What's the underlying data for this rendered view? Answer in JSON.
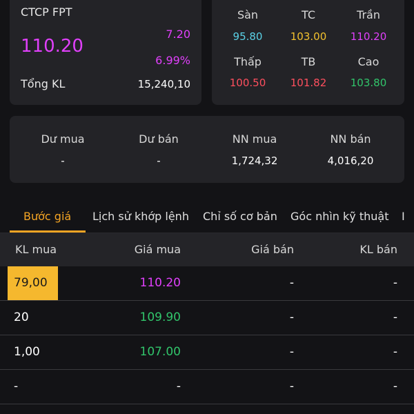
{
  "quote": {
    "company": "CTCP FPT",
    "price": "110.20",
    "change": "7.20",
    "change_pct": "6.99%",
    "volume_label": "Tổng KL",
    "volume": "15,240,10"
  },
  "stats": [
    {
      "label": "Sàn",
      "value": "95.80",
      "color": "#5ad1e6"
    },
    {
      "label": "TC",
      "value": "103.00",
      "color": "#f2c12e"
    },
    {
      "label": "Trần",
      "value": "110.20",
      "color": "#e040fb"
    },
    {
      "label": "Thấp",
      "value": "100.50",
      "color": "#ff4f5e"
    },
    {
      "label": "TB",
      "value": "101.82",
      "color": "#ff4f5e"
    },
    {
      "label": "Cao",
      "value": "103.80",
      "color": "#31c56b"
    }
  ],
  "flow": [
    {
      "label": "Dư mua",
      "value": "-"
    },
    {
      "label": "Dư bán",
      "value": "-"
    },
    {
      "label": "NN mua",
      "value": "1,724,32"
    },
    {
      "label": "NN bán",
      "value": "4,016,20"
    }
  ],
  "tabs": [
    "Bước giá",
    "Lịch sử khớp lệnh",
    "Chỉ số cơ bản",
    "Góc nhìn kỹ thuật",
    "I"
  ],
  "table": {
    "headers": [
      "KL mua",
      "Giá mua",
      "Giá bán",
      "KL bán"
    ],
    "rows": [
      {
        "kl_buy": "79,00",
        "price_buy": "110.20",
        "price_sell": "-",
        "kl_sell": "-"
      },
      {
        "kl_buy": "20",
        "price_buy": "109.90",
        "price_sell": "-",
        "kl_sell": "-"
      },
      {
        "kl_buy": "1,00",
        "price_buy": "107.00",
        "price_sell": "-",
        "kl_sell": "-"
      },
      {
        "kl_buy": "-",
        "price_buy": "-",
        "price_sell": "-",
        "kl_sell": "-"
      }
    ]
  },
  "colors": {
    "accent": "#f5a524",
    "ceiling": "#e040fb",
    "up": "#31c56b"
  }
}
